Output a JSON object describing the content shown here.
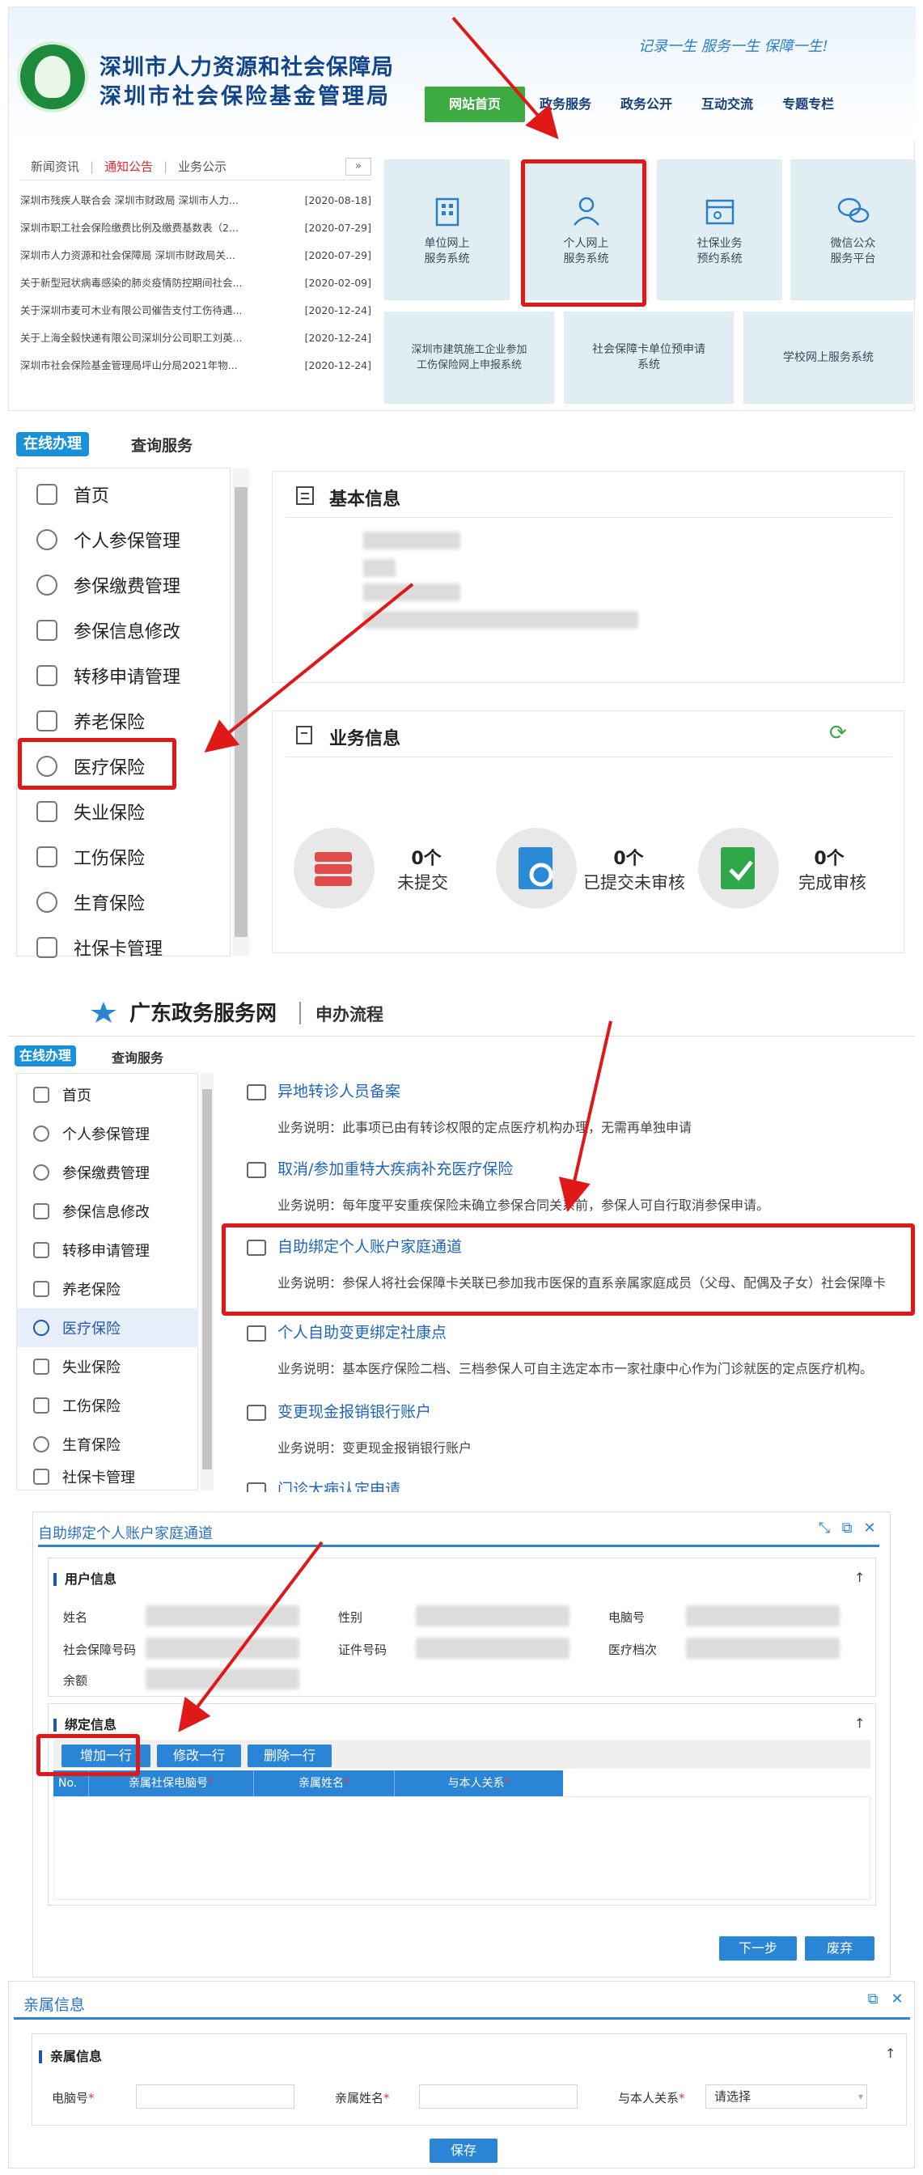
{
  "section1": {
    "org_title": "深圳市人力资源和社会保障局",
    "org_subtitle": "深圳市社会保险基金管理局",
    "slogan": "记录一生  服务一生  保障一生!",
    "nav": [
      "网站首页",
      "政务服务",
      "政务公开",
      "互动交流",
      "专题专栏"
    ],
    "news_tabs": [
      "新闻资讯",
      "通知公告",
      "业务公示"
    ],
    "news_more": "»",
    "news": [
      {
        "title": "深圳市残疾人联合会 深圳市财政局 深圳市人力...",
        "date": "[2020-08-18]"
      },
      {
        "title": "深圳市职工社会保险缴费比例及缴费基数表（2...",
        "date": "[2020-07-29]"
      },
      {
        "title": "深圳市人力资源和社会保障局 深圳市财政局关...",
        "date": "[2020-07-29]"
      },
      {
        "title": "关于新型冠状病毒感染的肺炎疫情防控期间社会...",
        "date": "[2020-02-09]"
      },
      {
        "title": "关于深圳市麦可木业有限公司催告支付工伤待遇...",
        "date": "[2020-12-24]"
      },
      {
        "title": "关于上海全毅快递有限公司深圳分公司职工刘英...",
        "date": "[2020-12-24]"
      },
      {
        "title": "深圳市社会保险基金管理局坪山分局2021年物...",
        "date": "[2020-12-24]"
      }
    ],
    "tiles": [
      {
        "line1": "单位网上",
        "line2": "服务系统"
      },
      {
        "line1": "个人网上",
        "line2": "服务系统"
      },
      {
        "line1": "社保业务",
        "line2": "预约系统"
      },
      {
        "line1": "微信公众",
        "line2": "服务平台"
      }
    ],
    "tiles_row2": [
      {
        "line1": "深圳市建筑施工企业参加",
        "line2": "工伤保险网上申报系统"
      },
      {
        "line1": "社会保障卡单位预申请",
        "line2": "系统"
      },
      {
        "line1": "学校网上服务系统",
        "line2": ""
      }
    ]
  },
  "section2": {
    "tab_active": "在线办理",
    "tab_other": "查询服务",
    "menu": [
      "首页",
      "个人参保管理",
      "参保缴费管理",
      "参保信息修改",
      "转移申请管理",
      "养老保险",
      "医疗保险",
      "失业保险",
      "工伤保险",
      "生育保险",
      "社保卡管理"
    ],
    "basic_info_title": "基本信息",
    "biz_info_title": "业务信息",
    "stats": [
      {
        "count": "0个",
        "label": "未提交"
      },
      {
        "count": "0个",
        "label": "已提交未审核"
      },
      {
        "count": "0个",
        "label": "完成审核"
      }
    ]
  },
  "section3": {
    "brand": "广东政务服务网",
    "flow": "申办流程",
    "tab_active": "在线办理",
    "tab_other": "查询服务",
    "menu": [
      "首页",
      "个人参保管理",
      "参保缴费管理",
      "参保信息修改",
      "转移申请管理",
      "养老保险",
      "医疗保险",
      "失业保险",
      "工伤保险",
      "生育保险",
      "社保卡管理"
    ],
    "services": [
      {
        "title": "异地转诊人员备案",
        "desc": "业务说明：此事项已由有转诊权限的定点医疗机构办理，无需再单独申请"
      },
      {
        "title": "取消/参加重特大疾病补充医疗保险",
        "desc": "业务说明：每年度平安重疾保险未确立参保合同关系前，参保人可自行取消参保申请。"
      },
      {
        "title": "自助绑定个人账户家庭通道",
        "desc": "业务说明：参保人将社会保障卡关联已参加我市医保的直系亲属家庭成员（父母、配偶及子女）社会保障卡"
      },
      {
        "title": "个人自助变更绑定社康点",
        "desc": "业务说明：基本医疗保险二档、三档参保人可自主选定本市一家社康中心作为门诊就医的定点医疗机构。"
      },
      {
        "title": "变更现金报销银行账户",
        "desc": "业务说明：变更现金报销银行账户"
      },
      {
        "title": "门诊大病认定申请",
        "desc": ""
      }
    ]
  },
  "section4": {
    "window_title": "自助绑定个人账户家庭通道",
    "user_info_title": "用户信息",
    "labels": {
      "name": "姓名",
      "gender": "性别",
      "pc_no": "电脑号",
      "ssc_no": "社会保障号码",
      "cert_no": "证件号码",
      "med_level": "医疗档次",
      "balance": "余额"
    },
    "bind_info_title": "绑定信息",
    "grid_buttons": [
      "增加一行",
      "修改一行",
      "删除一行"
    ],
    "grid_headers": [
      "No.",
      "亲属社保电脑号",
      "亲属姓名",
      "与本人关系"
    ],
    "required_mark": "*",
    "next_btn": "下一步",
    "abandon_btn": "废弃",
    "collapse_icon": "↑"
  },
  "section5": {
    "window_title": "亲属信息",
    "fs_title": "亲属信息",
    "labels": {
      "pc_no": "电脑号",
      "name": "亲属姓名",
      "relation": "与本人关系"
    },
    "relation_placeholder": "请选择",
    "save_btn": "保存",
    "collapse_icon": "↑"
  },
  "colors": {
    "brand_blue": "#12458c",
    "accent_green": "#3eaa42",
    "link_blue": "#1f66b8",
    "button_blue": "#2a85d6",
    "highlight_red": "#e01818"
  }
}
